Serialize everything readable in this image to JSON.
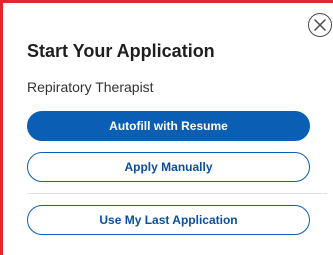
{
  "dialog": {
    "title": "Start Your Application",
    "job_title": "Repiratory Therapist",
    "close_icon": "close-circle-icon",
    "buttons": {
      "autofill": "Autofill with Resume",
      "manual": "Apply Manually",
      "last_application": "Use My Last Application"
    }
  },
  "colors": {
    "primary": "#0a5fb4",
    "outline_text": "#0a4f9c",
    "highlight_border": "#e0282e"
  }
}
